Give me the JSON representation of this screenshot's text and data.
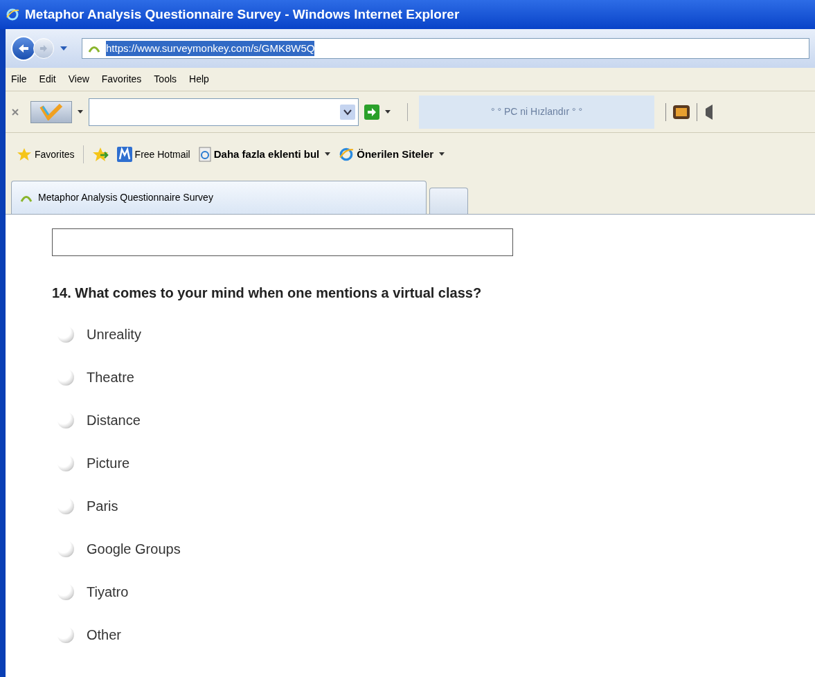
{
  "window": {
    "title": "Metaphor Analysis Questionnaire Survey - Windows Internet Explorer"
  },
  "address_bar": {
    "url": "https://www.surveymonkey.com/s/GMK8W5Q",
    "url_selected": true
  },
  "menu": [
    "File",
    "Edit",
    "View",
    "Favorites",
    "Tools",
    "Help"
  ],
  "toolbar": {
    "promo": "° ° PC ni Hızlandır ° °"
  },
  "favorites_bar": [
    {
      "label": "Favorites",
      "bold": false,
      "dropdown": false
    },
    {
      "label": "Free Hotmail",
      "bold": false,
      "dropdown": false
    },
    {
      "label": "Daha fazla eklenti bul",
      "bold": true,
      "dropdown": true
    },
    {
      "label": "Önerilen Siteler",
      "bold": true,
      "dropdown": true
    }
  ],
  "tabs": [
    {
      "label": "Metaphor Analysis Questionnaire Survey",
      "selected": true
    }
  ],
  "question": {
    "title": "14. What comes to your mind when one mentions a virtual class?",
    "options": [
      {
        "label": "Unreality",
        "selected": false
      },
      {
        "label": "Theatre",
        "selected": false
      },
      {
        "label": "Distance",
        "selected": false
      },
      {
        "label": "Picture",
        "selected": false
      },
      {
        "label": "Paris",
        "selected": false
      },
      {
        "label": "Google Groups",
        "selected": false
      },
      {
        "label": "Tiyatro",
        "selected": false
      },
      {
        "label": "Other",
        "selected": false
      }
    ]
  }
}
